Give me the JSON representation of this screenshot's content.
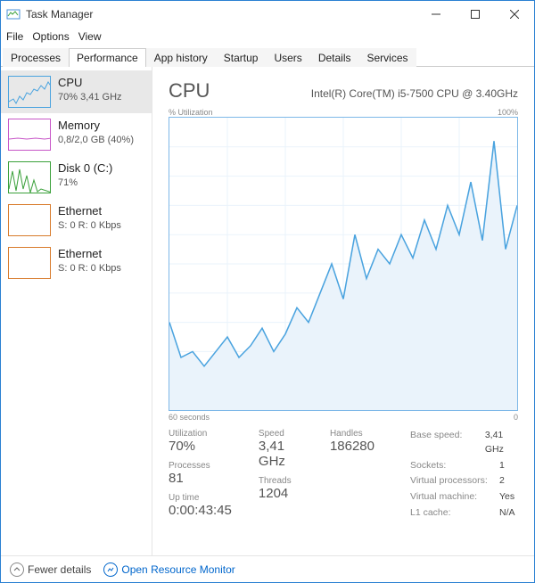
{
  "window": {
    "title": "Task Manager"
  },
  "menu": {
    "file": "File",
    "options": "Options",
    "view": "View"
  },
  "tabs": {
    "processes": "Processes",
    "performance": "Performance",
    "apphistory": "App history",
    "startup": "Startup",
    "users": "Users",
    "details": "Details",
    "services": "Services"
  },
  "sidebar": {
    "cpu": {
      "name": "CPU",
      "detail": "70% 3,41 GHz"
    },
    "memory": {
      "name": "Memory",
      "detail": "0,8/2,0 GB (40%)"
    },
    "disk": {
      "name": "Disk 0 (C:)",
      "detail": "71%"
    },
    "eth1": {
      "name": "Ethernet",
      "detail": "S: 0 R: 0 Kbps"
    },
    "eth2": {
      "name": "Ethernet",
      "detail": "S: 0 R: 0 Kbps"
    }
  },
  "main": {
    "title": "CPU",
    "subtitle": "Intel(R) Core(TM) i5-7500 CPU @ 3.40GHz",
    "chart_top_left": "% Utilization",
    "chart_top_right": "100%",
    "chart_bottom_left": "60 seconds",
    "chart_bottom_right": "0"
  },
  "stats": {
    "utilization_lbl": "Utilization",
    "utilization": "70%",
    "speed_lbl": "Speed",
    "speed": "3,41 GHz",
    "processes_lbl": "Processes",
    "processes": "81",
    "threads_lbl": "Threads",
    "threads": "1204",
    "handles_lbl": "Handles",
    "handles": "186280",
    "uptime_lbl": "Up time",
    "uptime": "0:00:43:45",
    "basespeed_lbl": "Base speed:",
    "basespeed": "3,41 GHz",
    "sockets_lbl": "Sockets:",
    "sockets": "1",
    "vproc_lbl": "Virtual processors:",
    "vproc": "2",
    "vmach_lbl": "Virtual machine:",
    "vmach": "Yes",
    "l1_lbl": "L1 cache:",
    "l1": "N/A"
  },
  "footer": {
    "fewer": "Fewer details",
    "resmon": "Open Resource Monitor"
  },
  "chart_data": {
    "type": "line",
    "title": "% Utilization",
    "xlabel": "60 seconds",
    "ylabel": "",
    "ylim": [
      0,
      100
    ],
    "x_seconds_ago": [
      60,
      58,
      56,
      54,
      52,
      50,
      48,
      46,
      44,
      42,
      40,
      38,
      36,
      34,
      32,
      30,
      28,
      26,
      24,
      22,
      20,
      18,
      16,
      14,
      12,
      10,
      8,
      6,
      4,
      2,
      0
    ],
    "values": [
      30,
      18,
      20,
      15,
      20,
      25,
      18,
      22,
      28,
      20,
      26,
      35,
      30,
      40,
      50,
      38,
      60,
      45,
      55,
      50,
      60,
      52,
      65,
      55,
      70,
      60,
      78,
      58,
      92,
      55,
      70
    ]
  }
}
